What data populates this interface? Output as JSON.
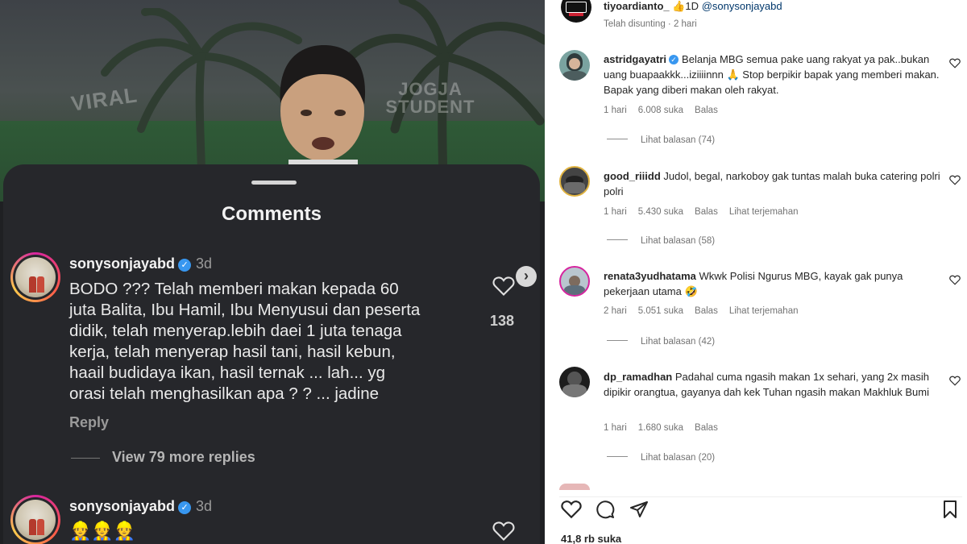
{
  "left": {
    "watermarks": [
      "VIRAL",
      "JOGJA STUDENT"
    ],
    "sheet_title": "Comments",
    "comments": [
      {
        "user": "sonysonjayabd",
        "time": "3d",
        "text_lines": [
          "BODO ??? Telah memberi makan kepada 60",
          "juta Balita, Ibu Hamil, Ibu Menyusui dan peserta",
          "didik, telah menyerap.lebih daei 1 juta tenaga",
          "kerja, telah menyerap hasil tani, hasil kebun,",
          "haail budidaya ikan, hasil ternak ... lah... yg",
          "orasi telah menghasilkan apa ? ? ... jadine"
        ],
        "likes": "138",
        "reply": "Reply",
        "view_replies": "View 79 more replies"
      },
      {
        "user": "sonysonjayabd",
        "time": "3d",
        "text": "👷👷👷"
      }
    ]
  },
  "right": {
    "post": {
      "user": "tiyoardianto_",
      "suffix": "👍1D",
      "mention": "@sonysonjayabd",
      "meta": "Telah disunting · 2 hari"
    },
    "comments": [
      {
        "user": "astridgayatri",
        "verified": true,
        "text": "Belanja MBG semua pake uang rakyat ya pak..bukan uang buapaakkk...iziiiinnn 🙏 Stop berpikir bapak yang memberi makan. Bapak yang diberi makan oleh rakyat.",
        "time": "1 hari",
        "likes": "6.008 suka",
        "reply": "Balas",
        "translate": "",
        "view": "Lihat balasan (74)"
      },
      {
        "user": "good_riiidd",
        "verified": false,
        "text": "Judol, begal, narkoboy gak tuntas malah buka catering polri polri",
        "time": "1 hari",
        "likes": "5.430 suka",
        "reply": "Balas",
        "translate": "Lihat terjemahan",
        "view": "Lihat balasan (58)"
      },
      {
        "user": "renata3yudhatama",
        "verified": false,
        "text": "Wkwk Polisi Ngurus MBG, kayak gak punya pekerjaan utama 🤣",
        "time": "2 hari",
        "likes": "5.051 suka",
        "reply": "Balas",
        "translate": "Lihat terjemahan",
        "view": "Lihat balasan (42)"
      },
      {
        "user": "dp_ramadhan",
        "verified": false,
        "text": "Padahal cuma ngasih makan 1x sehari, yang 2x masih dipikir orangtua, gayanya dah kek Tuhan ngasih makan Makhluk Bumi",
        "time": "1 hari",
        "likes": "1.680 suka",
        "reply": "Balas",
        "translate": "",
        "view": "Lihat balasan (20)"
      }
    ],
    "likes_total": "41,8 rb suka",
    "icons": [
      "heart-icon",
      "comment-icon",
      "share-icon",
      "bookmark-icon"
    ]
  }
}
